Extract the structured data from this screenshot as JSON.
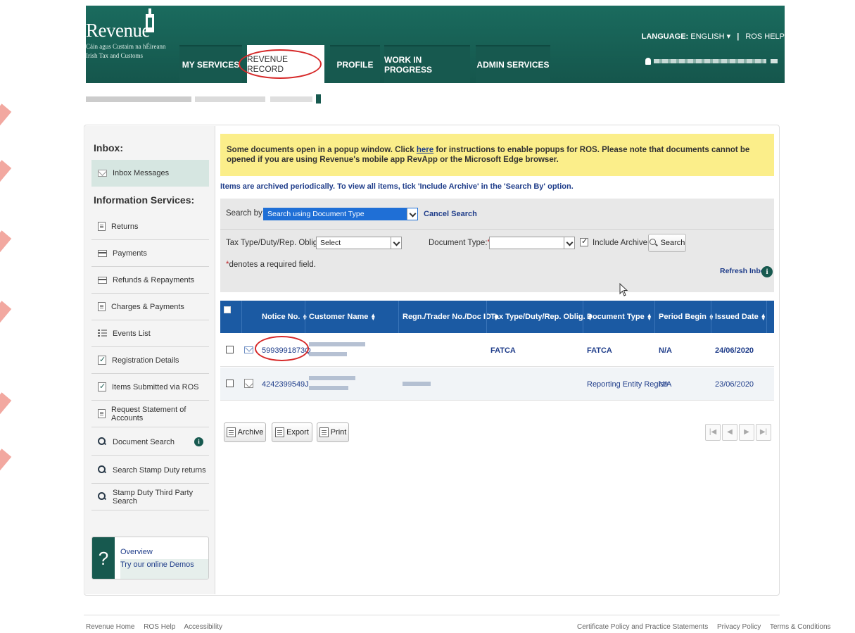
{
  "brand": {
    "logo_text": "Revenue",
    "subtitle_line1": "Cáin agus Custaim na hÉireann",
    "subtitle_line2": "Irish Tax and Customs",
    "color": "#1a6b5e"
  },
  "header": {
    "language_label": "LANGUAGE:",
    "language_value": "ENGLISH",
    "help_label": "ROS HELP"
  },
  "tabs": [
    {
      "label": "MY SERVICES"
    },
    {
      "label": "REVENUE RECORD",
      "active": true
    },
    {
      "label": "PROFILE"
    },
    {
      "label": "WORK IN PROGRESS"
    },
    {
      "label": "ADMIN SERVICES"
    }
  ],
  "sidebar": {
    "inbox_heading": "Inbox:",
    "inbox_item": "Inbox Messages",
    "info_heading": "Information Services:",
    "items": [
      {
        "label": "Returns",
        "icon": "returns-icon"
      },
      {
        "label": "Payments",
        "icon": "payments-icon"
      },
      {
        "label": "Refunds & Repayments",
        "icon": "refunds-icon"
      },
      {
        "label": "Charges & Payments",
        "icon": "charges-icon"
      },
      {
        "label": "Events List",
        "icon": "events-list-icon"
      },
      {
        "label": "Registration Details",
        "icon": "registration-icon"
      },
      {
        "label": "Items Submitted via ROS",
        "icon": "submitted-icon"
      },
      {
        "label": "Request Statement of Accounts",
        "icon": "statement-icon"
      },
      {
        "label": "Document Search",
        "icon": "search-icon"
      },
      {
        "label": "Search Stamp Duty returns",
        "icon": "search-icon"
      },
      {
        "label": "Stamp Duty Third Party Search",
        "icon": "search-icon"
      }
    ],
    "demo_title": "Overview",
    "demo_link": "Try our online Demos"
  },
  "notice": {
    "before_link": "Some documents open in a popup window. Click ",
    "link_text": "here",
    "after_link": " for instructions to enable popups for ROS. Please note that documents cannot be opened if you are using Revenue's mobile app RevApp or the Microsoft Edge browser."
  },
  "archive_message": "Items are archived periodically. To view all items, tick 'Include Archive' in the 'Search By' option.",
  "search": {
    "search_by_label": "Search by:",
    "search_by_value": "Search using Document Type",
    "cancel_label": "Cancel Search",
    "tax_type_label": "Tax Type/Duty/Rep. Oblig. :",
    "tax_type_value": "Select",
    "doc_type_label": "Document Type:",
    "doc_type_value": "",
    "include_archive_label": "Include Archive",
    "include_archive_checked": true,
    "search_button": "Search",
    "required_note": "denotes a required field.",
    "refresh_label": "Refresh Inbox"
  },
  "table": {
    "headers": [
      "Notice No.",
      "Customer Name",
      "Regn./Trader No./Doc ID",
      "Tax Type/Duty/Rep. Oblig.",
      "Document Type",
      "Period Begin",
      "Issued Date"
    ],
    "rows": [
      {
        "notice": "5993991873Q",
        "tax_type": "FATCA",
        "doc_type": "FATCA",
        "period": "N/A",
        "issued": "24/06/2020",
        "read": false
      },
      {
        "notice": "4242399549J",
        "tax_type": "",
        "doc_type": "Reporting Entity Registr",
        "period": "N/A",
        "issued": "23/06/2020",
        "read": true
      }
    ]
  },
  "actions": {
    "archive": "Archive",
    "export": "Export",
    "print": "Print"
  },
  "footer": {
    "left": [
      "Revenue Home",
      "ROS Help",
      "Accessibility"
    ],
    "right": [
      "Certificate Policy and Practice Statements",
      "Privacy Policy",
      "Terms & Conditions"
    ]
  }
}
